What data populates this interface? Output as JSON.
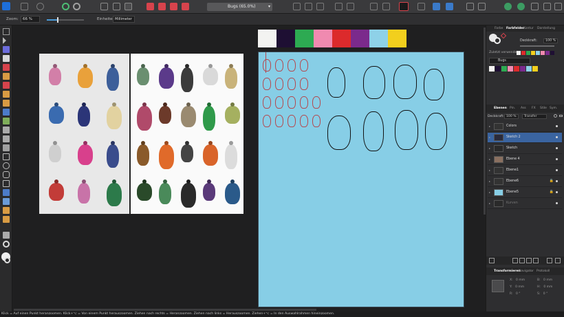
{
  "app": {
    "name": "Affinity Designer"
  },
  "topbar": {
    "document_title": "Bugs (65.0%)"
  },
  "context_toolbar": {
    "zoom_label": "Zoom:",
    "zoom_value": "66 %",
    "zoom_slider_level": 0.3,
    "units_label": "Einheiten:",
    "units_value": "Millimeter"
  },
  "color_panel": {
    "tabs": [
      "Farbe",
      "Farbfelder",
      "Kontur",
      "Darstellung"
    ],
    "active_tab": "Farbfelder",
    "opacity_label": "Deckkraft:",
    "opacity_value": "100 %",
    "recent_label": "Zuletzt verwendet:",
    "palette_name": "Bugs"
  },
  "swatch_colors": [
    "#f3f3f1",
    "#1e0f33",
    "#2daa52",
    "#f08ab0",
    "#dc2a2c",
    "#7b2a8c",
    "#8ed1e8",
    "#f2cf1d"
  ],
  "recent_colors": [
    "#f3f3f1",
    "#dc2a2c",
    "#2daa52",
    "#f2cf1d",
    "#8ed1e8",
    "#f08ab0",
    "#7b2a8c",
    "#1e0f33"
  ],
  "layers_panel": {
    "tabs": [
      "Ebenen",
      "Pin.",
      "Ass",
      "FX",
      "Stile",
      "Sym."
    ],
    "active_tab": "Ebenen",
    "opacity_label": "Deckkraft:",
    "opacity_value": "100 %",
    "blend_mode": "Transfer",
    "layers": [
      {
        "name": "Colors",
        "selected": false,
        "locked": false
      },
      {
        "name": "Sketch 2",
        "selected": true,
        "locked": false
      },
      {
        "name": "Sketch",
        "selected": false,
        "locked": false
      },
      {
        "name": "Ebene 4",
        "selected": false,
        "locked": false
      },
      {
        "name": "Ebene1",
        "selected": false,
        "locked": false
      },
      {
        "name": "Ebene6",
        "selected": false,
        "locked": true
      },
      {
        "name": "Ebene5",
        "selected": false,
        "locked": true
      },
      {
        "name": "Kurven",
        "selected": false,
        "locked": false
      }
    ]
  },
  "transform_panel": {
    "tabs": [
      "Transformieren",
      "Navigator",
      "Protokoll"
    ],
    "active_tab": "Transformieren",
    "fields": [
      {
        "label": "X:",
        "value": "0 mm"
      },
      {
        "label": "B:",
        "value": "0 mm"
      },
      {
        "label": "Y:",
        "value": "0 mm"
      },
      {
        "label": "H:",
        "value": "0 mm"
      },
      {
        "label": "R:",
        "value": "0 °"
      },
      {
        "label": "S:",
        "value": "0 °"
      }
    ]
  },
  "status": {
    "text": "Klick = Auf einen Punkt heranzoomen. Klick+⌥ = Von einem Punkt herauszoomen. Ziehen nach rechts = Heranzoomen. Ziehen nach links = Herauszoomen. Ziehen+⌥ = In den Auswahlrahmen hineinzoomen."
  }
}
